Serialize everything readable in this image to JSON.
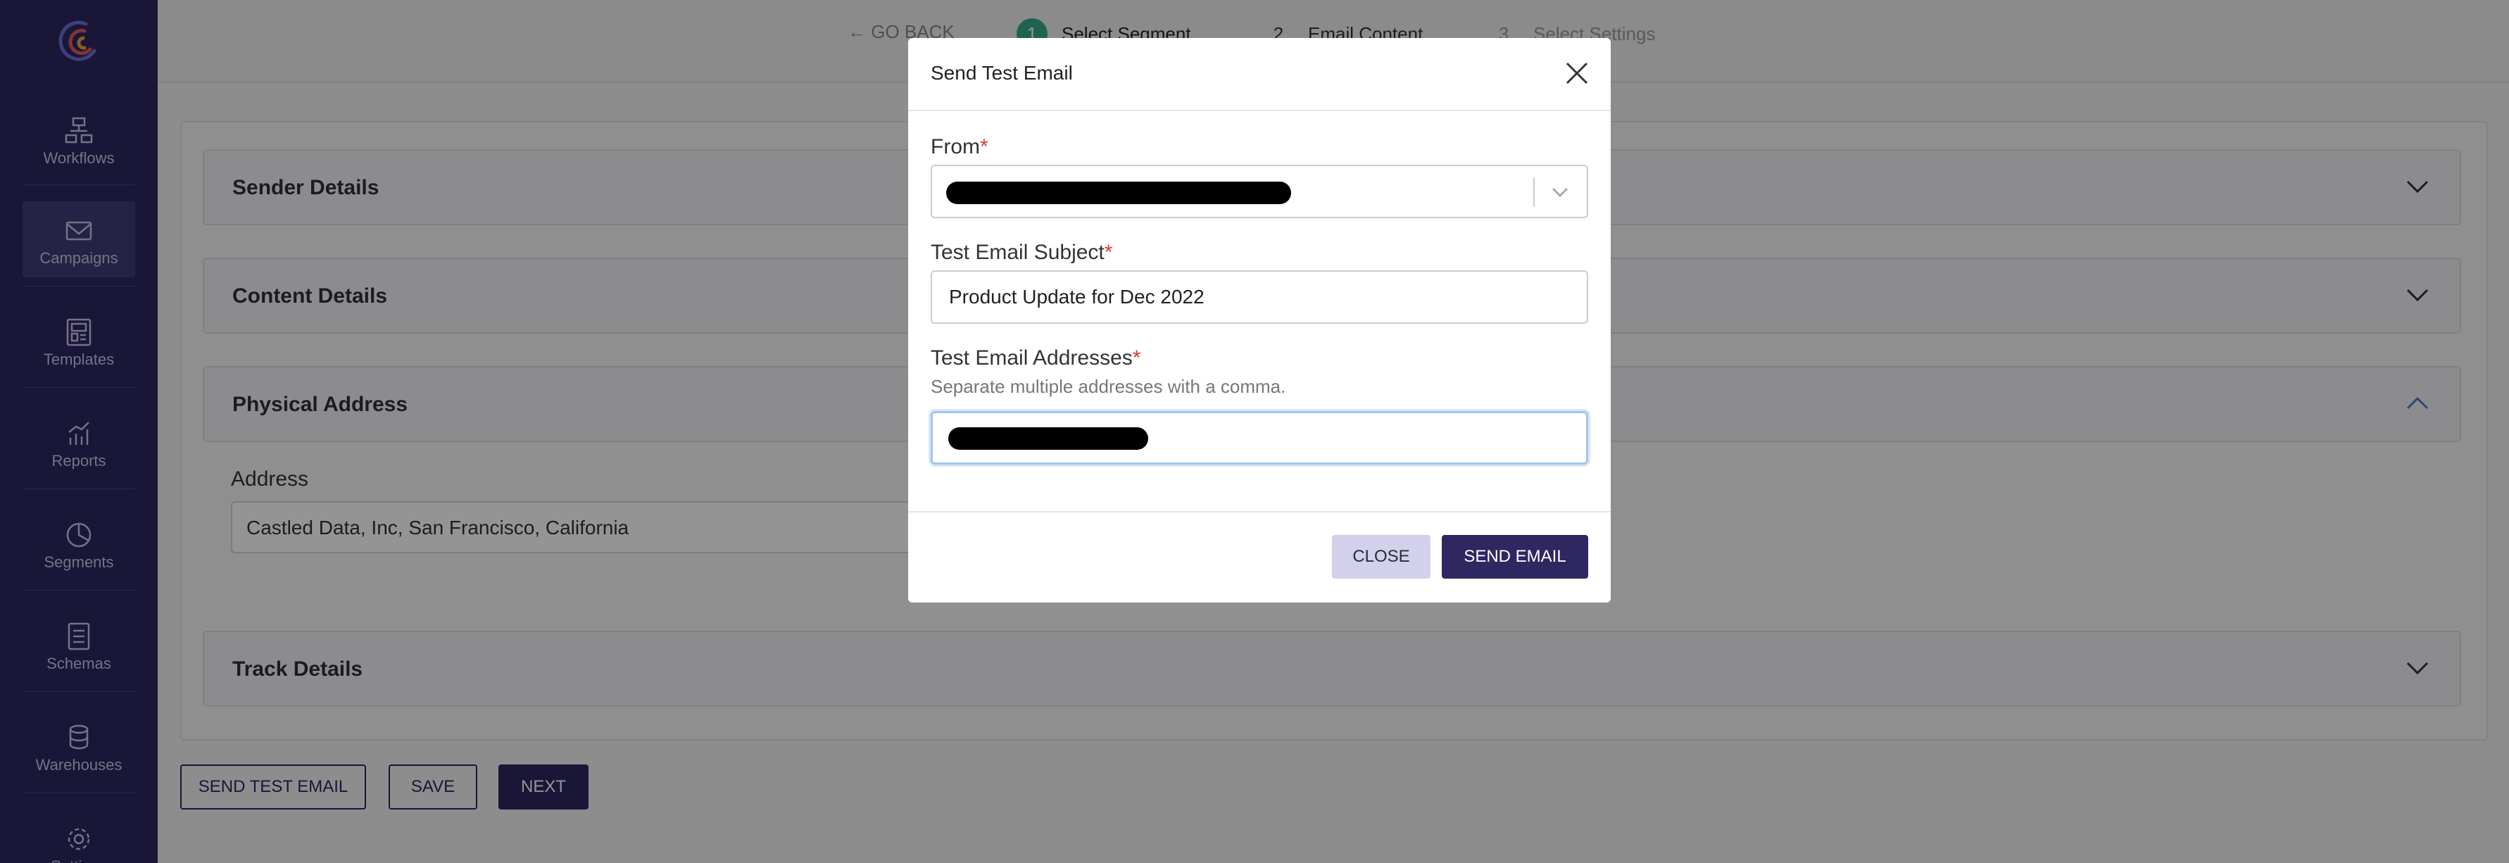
{
  "sidebar": {
    "logo": "castled-logo-icon",
    "items": [
      {
        "label": "Workflows",
        "icon": "workflow-icon"
      },
      {
        "label": "Campaigns",
        "icon": "envelope-icon",
        "active": true
      },
      {
        "label": "Templates",
        "icon": "template-icon"
      },
      {
        "label": "Reports",
        "icon": "chart-icon"
      },
      {
        "label": "Segments",
        "icon": "pie-icon"
      },
      {
        "label": "Schemas",
        "icon": "document-icon"
      },
      {
        "label": "Warehouses",
        "icon": "database-icon"
      },
      {
        "label": "Settings",
        "icon": "gear-icon"
      }
    ]
  },
  "topbar": {
    "back_label": "GO BACK",
    "steps": [
      {
        "num": "1",
        "label": "Select Segment"
      },
      {
        "num": "2",
        "label": "Email Content"
      },
      {
        "num": "3",
        "label": "Select Settings"
      }
    ]
  },
  "sections": {
    "sender": "Sender Details",
    "content": "Content Details",
    "physical": "Physical Address",
    "track": "Track Details"
  },
  "address": {
    "label": "Address",
    "value": "Castled Data, Inc, San Francisco, California"
  },
  "actions": {
    "send_test": "SEND TEST EMAIL",
    "save": "SAVE",
    "next": "NEXT"
  },
  "modal": {
    "title": "Send Test Email",
    "from_label": "From",
    "subject_label": "Test Email Subject",
    "subject_value": "Product Update for Dec 2022",
    "addresses_label": "Test Email Addresses",
    "addresses_help": "Separate multiple addresses with a comma.",
    "required_mark": "*",
    "close_label": "CLOSE",
    "send_label": "SEND EMAIL"
  },
  "colors": {
    "sidebar": "#2e2761",
    "accent": "#2e2761",
    "required": "#d63a3a",
    "step_active": "#3aa88a"
  }
}
